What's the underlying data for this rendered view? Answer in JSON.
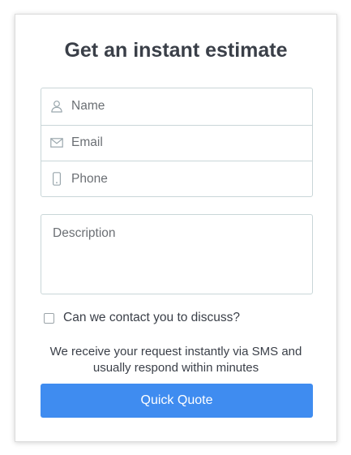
{
  "form": {
    "title": "Get an instant estimate",
    "fields": [
      {
        "placeholder": "Name",
        "value": "",
        "icon": "user-icon"
      },
      {
        "placeholder": "Email",
        "value": "",
        "icon": "envelope-icon"
      },
      {
        "placeholder": "Phone",
        "value": "",
        "icon": "phone-icon"
      }
    ],
    "description": {
      "placeholder": "Description",
      "value": ""
    },
    "consent": {
      "label": "Can we contact you to discuss?",
      "checked": false
    },
    "note": "We receive your request instantly via SMS and usually respond within minutes",
    "submit_label": "Quick Quote"
  },
  "colors": {
    "accent": "#3f8cf0",
    "border": "#c9d6d8",
    "text": "#3a3f48",
    "icon": "#9aa7ad"
  }
}
